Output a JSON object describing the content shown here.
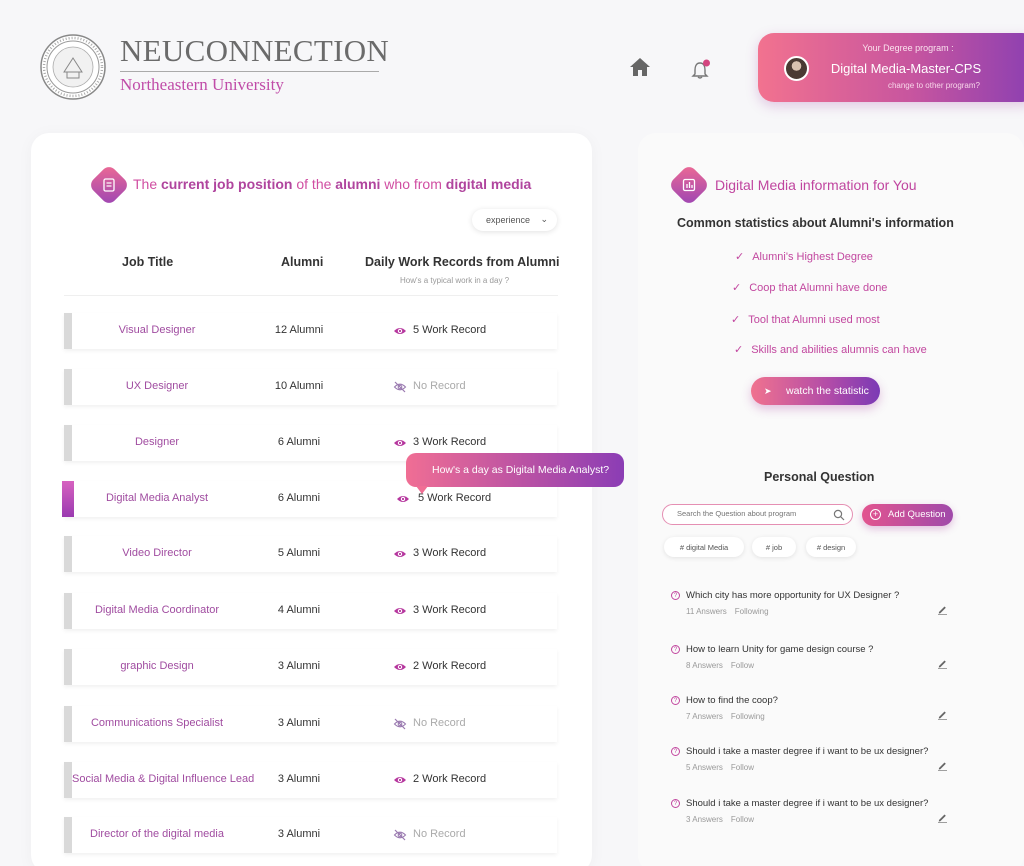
{
  "brand": {
    "title": "NEUCONNECTION",
    "subtitle": "Northeastern University"
  },
  "program": {
    "kicker": "Your Degree program :",
    "name": "Digital Media-Master-CPS",
    "change": "change to other program?"
  },
  "left": {
    "heading": {
      "p1": "The ",
      "b1": "current job position",
      "p2": " of the ",
      "b2": "alumni",
      "p3": " who from ",
      "b3": "digital media"
    },
    "filter": "experience",
    "columns": {
      "job": "Job Title",
      "alumni": "Alumni",
      "records": "Daily Work Records from Alumni",
      "records_sub": "How's a typical work in a day ?"
    },
    "rows": [
      {
        "title": "Visual Designer",
        "count": "12 Alumni",
        "record": "5 Work Record",
        "has": true
      },
      {
        "title": "UX Designer",
        "count": "10 Alumni",
        "record": "No Record",
        "has": false
      },
      {
        "title": "Designer",
        "count": "6 Alumni",
        "record": "3 Work Record",
        "has": true
      },
      {
        "title": "Digital Media Analyst",
        "count": "6 Alumni",
        "record": "5 Work Record",
        "has": true
      },
      {
        "title": "Video Director",
        "count": "5 Alumni",
        "record": "3 Work Record",
        "has": true
      },
      {
        "title": "Digital Media Coordinator",
        "count": "4 Alumni",
        "record": "3 Work Record",
        "has": true
      },
      {
        "title": "graphic Design",
        "count": "3 Alumni",
        "record": "2 Work Record",
        "has": true
      },
      {
        "title": "Communications Specialist",
        "count": "3 Alumni",
        "record": "No Record",
        "has": false
      },
      {
        "title": "Social Media & Digital Influence Lead",
        "count": "3 Alumni",
        "record": "2 Work Record",
        "has": true
      },
      {
        "title": "Director of the digital media",
        "count": "3 Alumni",
        "record": "No Record",
        "has": false
      }
    ],
    "tooltip": "How's a day as Digital Media Analyst?"
  },
  "right": {
    "heading": "Digital Media information for You",
    "stats_title": "Common statistics about Alumni's information",
    "stats": [
      "Alumni's Highest Degree",
      "Coop that Alumni have done",
      "Tool that Alumni used most",
      "Skills and abilities alumnis can have"
    ],
    "stats_button": "watch the statistic",
    "pq_title": "Personal Question",
    "search_placeholder": "Search the Question about program",
    "add_question": "Add Question",
    "tags": [
      "# digital Media",
      "# job",
      "# design"
    ],
    "questions": [
      {
        "text": "Which city has more opportunity for UX Designer ?",
        "answers": "11 Answers",
        "status": "Following"
      },
      {
        "text": "How to learn Unity for game design course ?",
        "answers": "8 Answers",
        "status": "Follow"
      },
      {
        "text": "How to find the coop?",
        "answers": "7 Answers",
        "status": "Following"
      },
      {
        "text": "Should i take a master degree if i want to be  ux designer?",
        "answers": "5 Answers",
        "status": "Follow"
      },
      {
        "text": "Should i take a master degree if i want to be ux designer?",
        "answers": "3 Answers",
        "status": "Follow"
      }
    ]
  },
  "colors": {
    "accent": "#c2479f",
    "gradient_start": "#f2728f",
    "gradient_end": "#8a3fb2"
  }
}
